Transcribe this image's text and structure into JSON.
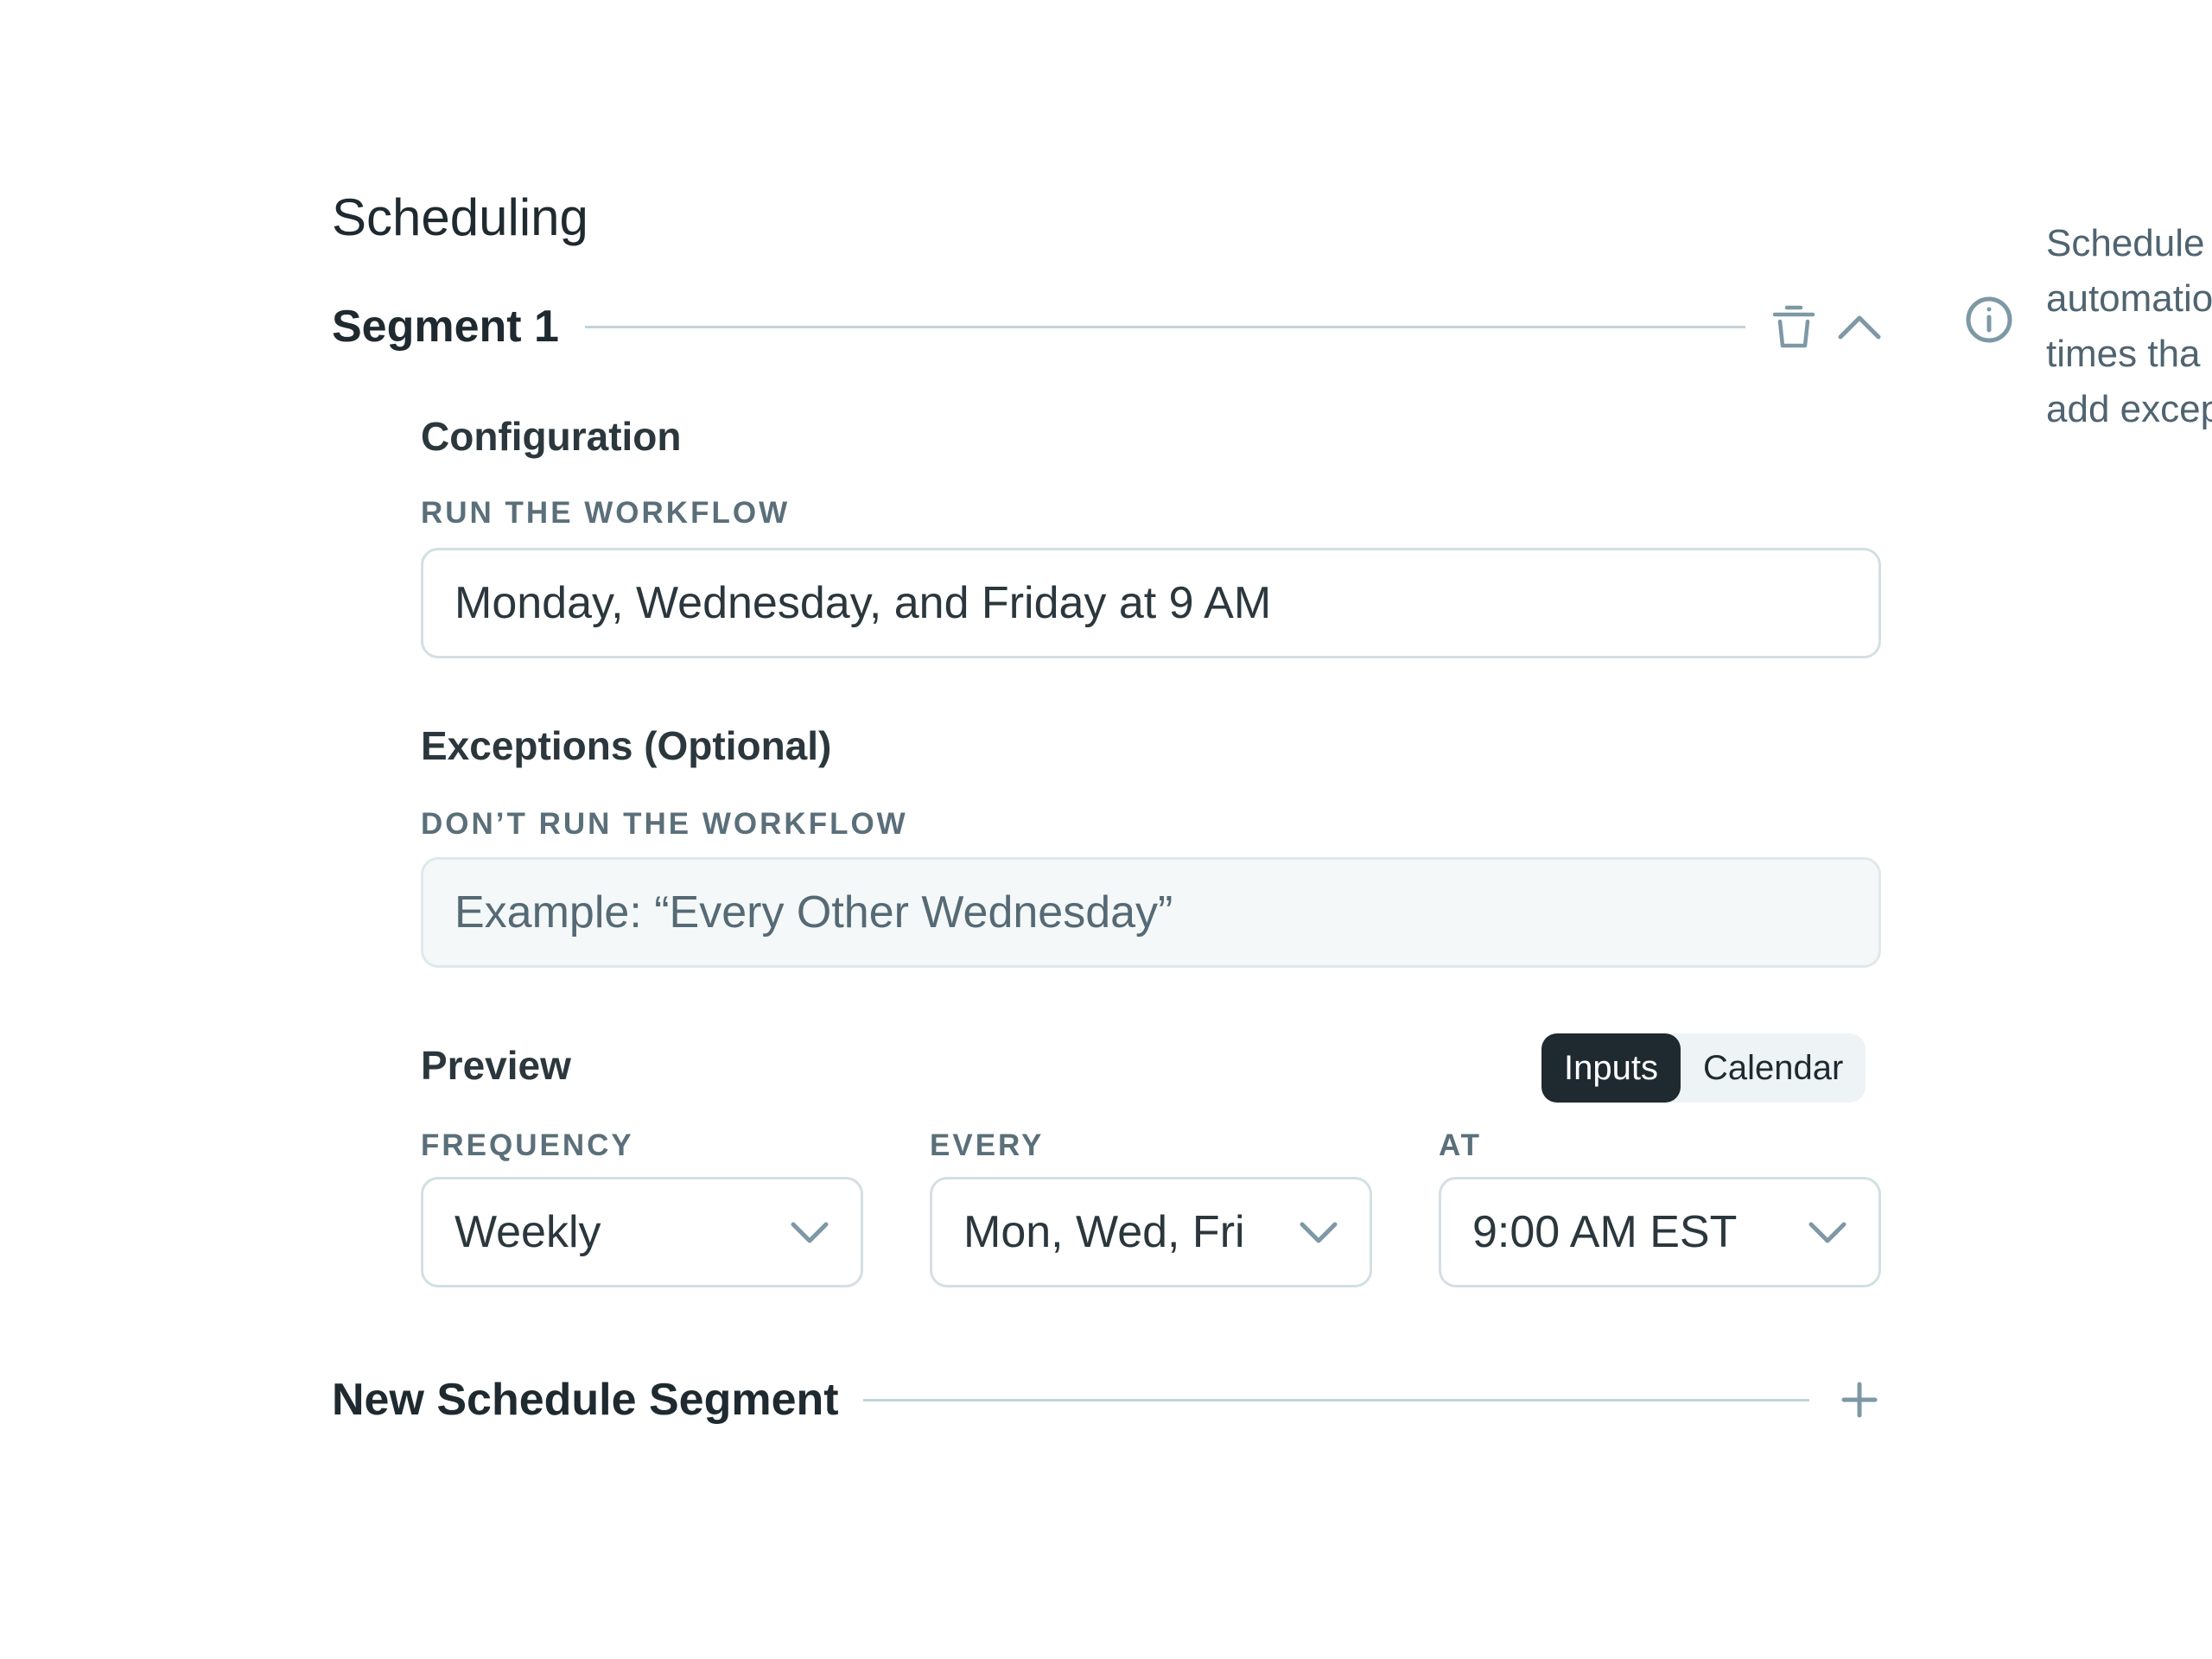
{
  "page": {
    "heading": "Scheduling"
  },
  "segment": {
    "title": "Segment 1",
    "configuration": {
      "title": "Configuration",
      "run_label": "RUN THE WORKFLOW",
      "run_value": "Monday, Wednesday, and Friday at 9 AM"
    },
    "exceptions": {
      "title": "Exceptions (Optional)",
      "label": "DON’T RUN THE WORKFLOW",
      "placeholder": "Example: “Every Other Wednesday”"
    },
    "preview": {
      "title": "Preview",
      "toggle": {
        "options": [
          "Inputs",
          "Calendar"
        ],
        "selected": "Inputs"
      },
      "fields": [
        {
          "label": "FREQUENCY",
          "value": "Weekly"
        },
        {
          "label": "EVERY",
          "value": "Mon, Wed, Fri"
        },
        {
          "label": "AT",
          "value": "9:00 AM EST"
        }
      ]
    }
  },
  "new_segment": {
    "label": "New Schedule Segment"
  },
  "side_panel": {
    "lines": [
      "Schedule",
      "automatio",
      "times tha",
      "add excep"
    ]
  },
  "colors": {
    "text_dark": "#1f2a30",
    "label_gray": "#5a6f7a",
    "icon_gray": "#7e98a5",
    "border": "#d3dfe4",
    "toggle_active_bg": "#1f2a30"
  },
  "icons": {
    "delete": "trash-icon",
    "collapse": "chevron-up-icon",
    "info": "info-icon",
    "dropdown": "chevron-down-icon",
    "add": "plus-icon"
  }
}
